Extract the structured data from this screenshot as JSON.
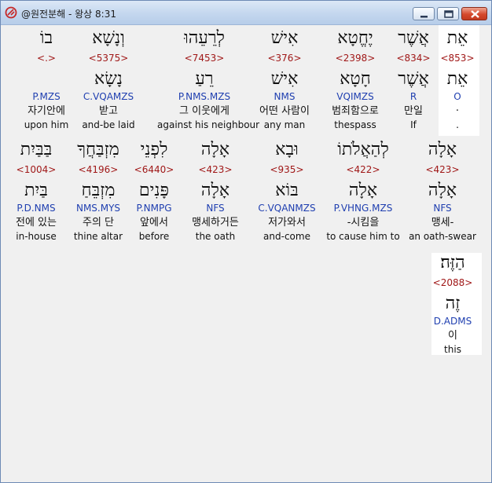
{
  "window": {
    "title": "@원전분해 - 왕상 8:31",
    "buttons": {
      "minimize": "minimize",
      "maximize": "maximize",
      "close": "close"
    }
  },
  "colors": {
    "strongs": "#a01818",
    "morph": "#1f3fb0",
    "titlebar": "#c6d8ef",
    "close": "#d5482c"
  },
  "rows": [
    {
      "words": [
        {
          "hebrew": "אֵת",
          "strongs": "<853>",
          "root": "אֵת",
          "morph": "O",
          "korean": "·",
          "english": "."
        },
        {
          "hebrew": "אֲשֶׁר",
          "strongs": "<834>",
          "root": "אֲשֶׁר",
          "morph": "R",
          "korean": "만일",
          "english": "If"
        },
        {
          "hebrew": "יֶחֱטָא",
          "strongs": "<2398>",
          "root": "חָטָא",
          "morph": "VQIMZS",
          "korean": "범죄함으로",
          "english": "thespass"
        },
        {
          "hebrew": "אִישׁ",
          "strongs": "<376>",
          "root": "אִישׁ",
          "morph": "NMS",
          "korean": "어떤 사람이",
          "english": "any man"
        },
        {
          "hebrew": "לְרֵעֵהוּ",
          "strongs": "<7453>",
          "root": "רֵעַ",
          "morph": "P.NMS.MZS",
          "korean": "그 이웃에게",
          "english": "against his neighbour"
        },
        {
          "hebrew": "וְנָשָׁא",
          "strongs": "<5375>",
          "root": "נָשָׂא",
          "morph": "C.VQAMZS",
          "korean": "받고",
          "english": "and-be laid"
        },
        {
          "hebrew": "בוֹ",
          "strongs": "<.>",
          "root": "",
          "morph": "P.MZS",
          "korean": "자기안에",
          "english": "upon him"
        }
      ]
    },
    {
      "words": [
        {
          "hebrew": "אָלָה",
          "strongs": "<423>",
          "root": "אָלָה",
          "morph": "NFS",
          "korean": "맹세-",
          "english": "an oath-swear"
        },
        {
          "hebrew": "לְהַאֲלֹתוֹ",
          "strongs": "<422>",
          "root": "אָלָה",
          "morph": "P.VHNG.MZS",
          "korean": "-시킴을",
          "english": "to cause him to"
        },
        {
          "hebrew": "וּבָא",
          "strongs": "<935>",
          "root": "בּוֹא",
          "morph": "C.VQANMZS",
          "korean": "저가와서",
          "english": "and-come"
        },
        {
          "hebrew": "אָלָה",
          "strongs": "<423>",
          "root": "אָלָה",
          "morph": "NFS",
          "korean": "맹세하거든",
          "english": "the oath"
        },
        {
          "hebrew": "לִפְנֵי",
          "strongs": "<6440>",
          "root": "פָּנִים",
          "morph": "P.NMPG",
          "korean": "앞에서",
          "english": "before"
        },
        {
          "hebrew": "מִזְבַּחֲךָ",
          "strongs": "<4196>",
          "root": "מִזְבֵּחַ",
          "morph": "NMS.MYS",
          "korean": "주의 단",
          "english": "thine altar"
        },
        {
          "hebrew": "בַּבַּיִת",
          "strongs": "<1004>",
          "root": "בַּיִת",
          "morph": "P.D.NMS",
          "korean": "전에 있는",
          "english": "in-house"
        }
      ]
    },
    {
      "words": [
        {
          "hebrew": "הַזֶּה׃",
          "strongs": "<2088>",
          "root": "זֶה",
          "morph": "D.ADMS",
          "korean": "이",
          "english": "this"
        }
      ]
    }
  ]
}
